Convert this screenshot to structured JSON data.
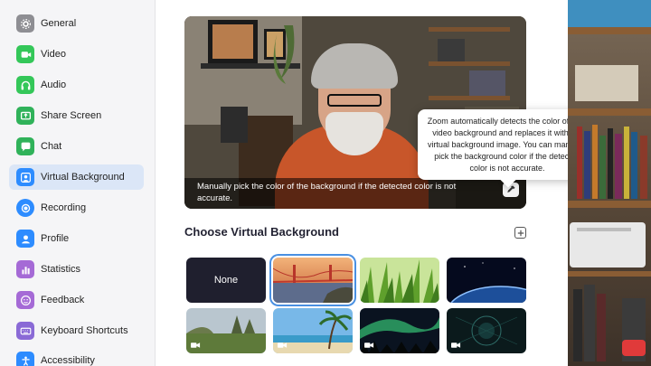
{
  "sidebar": {
    "items": [
      {
        "label": "General",
        "icon": "gear-icon",
        "color": "#8e8e93"
      },
      {
        "label": "Video",
        "icon": "video-icon",
        "color": "#34c759"
      },
      {
        "label": "Audio",
        "icon": "headphones-icon",
        "color": "#34c759"
      },
      {
        "label": "Share Screen",
        "icon": "share-screen-icon",
        "color": "#30b25a"
      },
      {
        "label": "Chat",
        "icon": "chat-icon",
        "color": "#30b25a"
      },
      {
        "label": "Virtual Background",
        "icon": "person-icon",
        "color": "#2d8cff",
        "active": true
      },
      {
        "label": "Recording",
        "icon": "record-icon",
        "color": "#2d8cff"
      },
      {
        "label": "Profile",
        "icon": "profile-icon",
        "color": "#2d8cff"
      },
      {
        "label": "Statistics",
        "icon": "bar-chart-icon",
        "color": "#a56ad6"
      },
      {
        "label": "Feedback",
        "icon": "smiley-icon",
        "color": "#a56ad6"
      },
      {
        "label": "Keyboard Shortcuts",
        "icon": "keyboard-icon",
        "color": "#8a6ad6"
      },
      {
        "label": "Accessibility",
        "icon": "accessibility-icon",
        "color": "#2d8cff"
      }
    ]
  },
  "preview": {
    "caption": "Manually pick the color of the background if the detected color is not accurate.",
    "picker_icon": "eyedropper-icon"
  },
  "tooltip": {
    "text": "Zoom automatically detects the color of your video background and replaces it with the virtual background image. You can manually pick the background color if the detected color is not accurate."
  },
  "backgrounds": {
    "title": "Choose Virtual Background",
    "add_icon": "plus-icon",
    "items": [
      {
        "label": "None",
        "kind": "none"
      },
      {
        "label": "",
        "kind": "golden-gate",
        "selected": true
      },
      {
        "label": "",
        "kind": "grass"
      },
      {
        "label": "",
        "kind": "earth"
      },
      {
        "label": "",
        "kind": "meadow",
        "video": true
      },
      {
        "label": "",
        "kind": "beach",
        "video": true
      },
      {
        "label": "",
        "kind": "aurora",
        "video": true
      },
      {
        "label": "",
        "kind": "earth-orbit",
        "video": true
      }
    ]
  },
  "colors": {
    "accent": "#4a90e2",
    "active_nav": "#dbe6f7"
  }
}
